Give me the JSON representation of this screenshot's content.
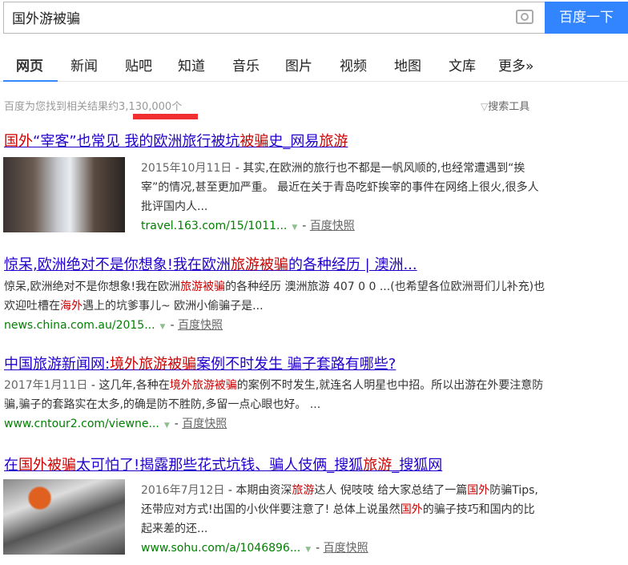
{
  "search": {
    "query": "国外游被骗",
    "button": "百度一下"
  },
  "tabs": [
    "网页",
    "新闻",
    "贴吧",
    "知道",
    "音乐",
    "图片",
    "视频",
    "地图",
    "文库",
    "更多»"
  ],
  "stats": {
    "prefix": "百度为您找到相关结果约",
    "count": "3,130,000",
    "suffix": "个"
  },
  "tools": "搜索工具",
  "results": [
    {
      "title": [
        [
          "国外",
          1
        ],
        [
          "“宰客”也常见 我的欧洲旅行被坑",
          0
        ],
        [
          "被骗",
          1
        ],
        [
          "史_网易",
          0
        ],
        [
          "旅游",
          1
        ]
      ],
      "date": "2015年10月11日",
      "abstract": [
        [
          "- 其实,在欧洲的旅行也不都是一帆风顺的,也经常遭遇到“挨宰”的情况,甚至更加严重。 最近在关于青岛吃虾挨宰的事件在网络上很火,很多人批评国内人...",
          0
        ]
      ],
      "url": "travel.163.com/15/1011...",
      "snapshot": "百度快照"
    },
    {
      "title": [
        [
          "惊呆,欧洲绝对不是你想象!我在欧洲",
          0
        ],
        [
          "旅游被骗",
          1
        ],
        [
          "的各种经历 | 澳洲...",
          0
        ]
      ],
      "date": "",
      "abstract": [
        [
          "惊呆,欧洲绝对不是你想象!我在欧洲",
          0
        ],
        [
          "旅游被骗",
          1
        ],
        [
          "的各种经历 澳洲旅游 407 0 0 ...(也希望各位欧洲哥们儿补充)也欢迎吐槽在",
          0
        ],
        [
          "海外",
          1
        ],
        [
          "遇上的坑爹事儿~ 欧洲小偷骗子是...",
          0
        ]
      ],
      "url": "news.china.com.au/2015...",
      "snapshot": "百度快照"
    },
    {
      "title": [
        [
          "中国旅游新闻网:",
          0
        ],
        [
          "境外旅游被骗",
          1
        ],
        [
          "案例不时发生 骗子套路有哪些?",
          0
        ]
      ],
      "date": "2017年1月11日",
      "abstract": [
        [
          "- 这几年,各种在",
          0
        ],
        [
          "境外旅游被骗",
          1
        ],
        [
          "的案例不时发生,就连名人明星也中招。所以出游在外要注意防骗,骗子的套路实在太多,的确是防不胜防,多留一点心眼也好。 ...",
          0
        ]
      ],
      "url": "www.cntour2.com/viewne...",
      "snapshot": "百度快照"
    },
    {
      "title": [
        [
          "在",
          0
        ],
        [
          "国外被骗",
          1
        ],
        [
          "太可怕了!揭露那些花式坑钱、骗人伎俩_搜狐",
          0
        ],
        [
          "旅游",
          1
        ],
        [
          "_搜狐网",
          0
        ]
      ],
      "date": "2016年7月12日",
      "abstract": [
        [
          "- 本期由资深",
          0
        ],
        [
          "旅游",
          1
        ],
        [
          "达人 倪吱吱 给大家总结了一篇",
          0
        ],
        [
          "国外",
          1
        ],
        [
          "防骗Tips,还带应对方式!出国的小伙伴要注意了! 总体上说虽然",
          0
        ],
        [
          "国外",
          1
        ],
        [
          "的骗子技巧和国内的比起来差的还...",
          0
        ]
      ],
      "url": "www.sohu.com/a/1046896...",
      "snapshot": "百度快照"
    }
  ]
}
